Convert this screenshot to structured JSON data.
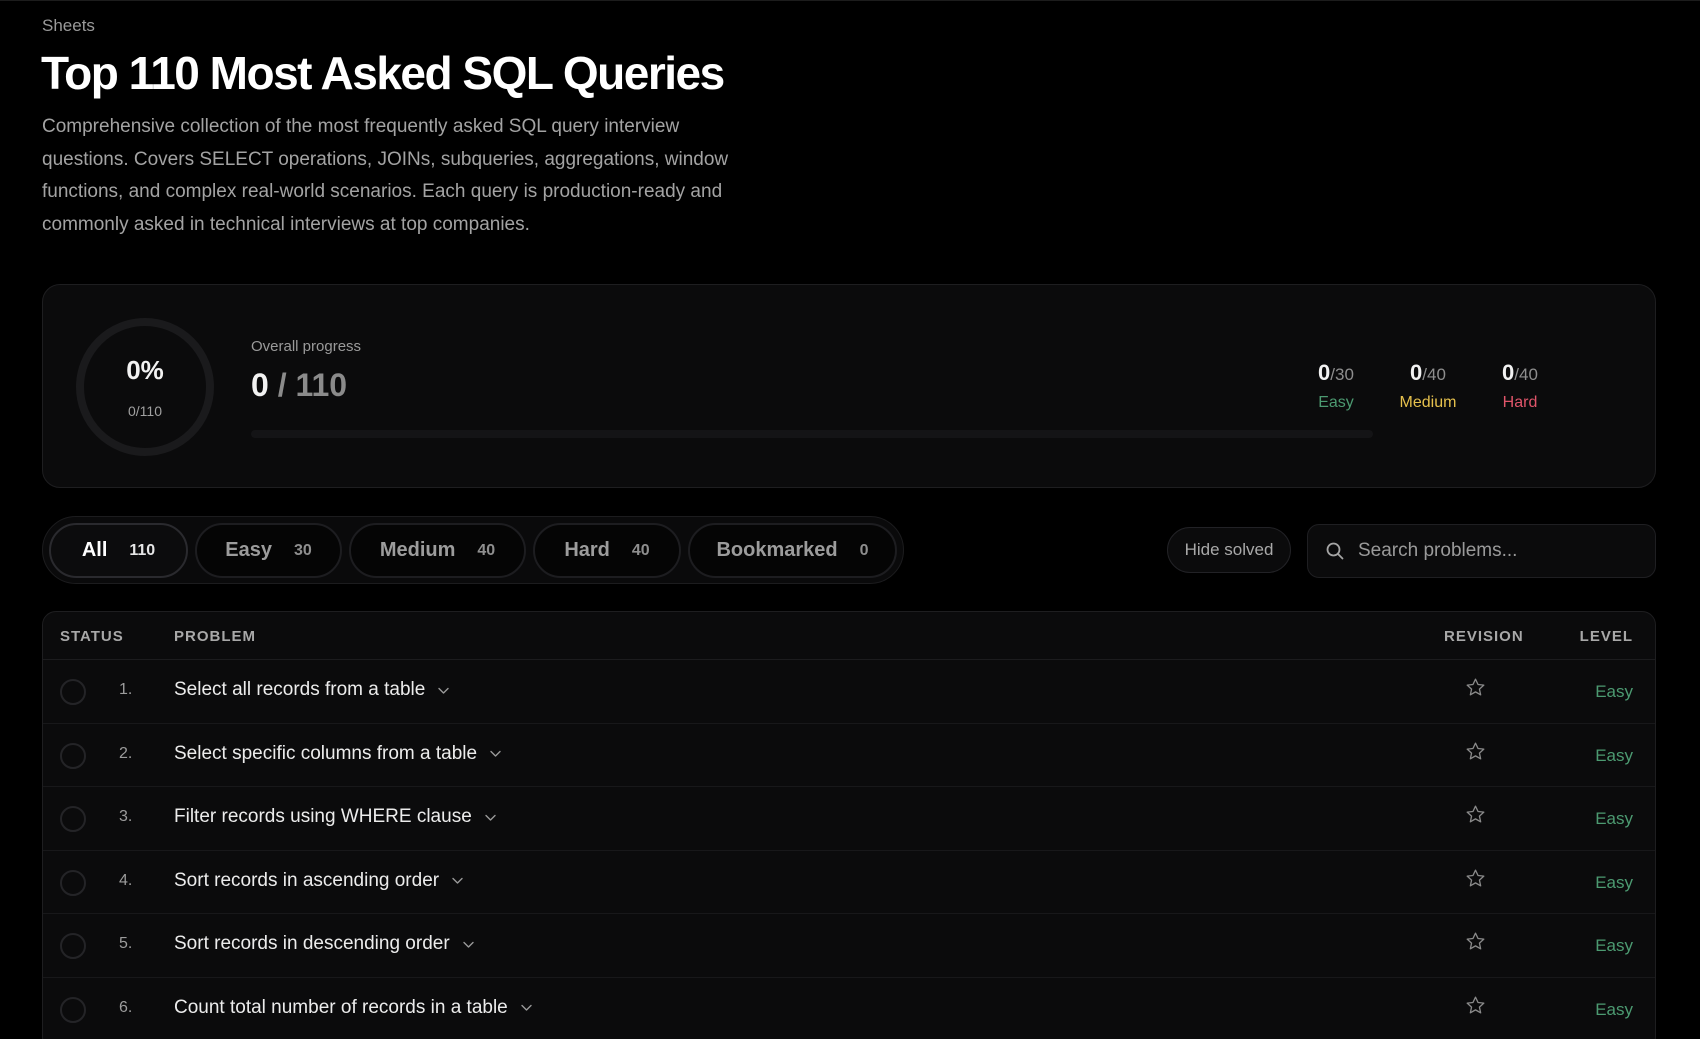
{
  "breadcrumb": "Sheets",
  "title": "Top 110 Most Asked SQL Queries",
  "description": "Comprehensive collection of the most frequently asked SQL query interview questions. Covers SELECT operations, JOINs, subqueries, aggregations, window functions, and complex real-world scenarios. Each query is production-ready and commonly asked in technical interviews at top companies.",
  "progress": {
    "percent_label": "0%",
    "ring_count": "0/110",
    "fraction_complete": 0,
    "overall_label": "Overall progress",
    "solved": "0",
    "separator": " / ",
    "total": "110",
    "difficulties": [
      {
        "solved": "0",
        "total": "/30",
        "label": "Easy",
        "color": "#4c9a71"
      },
      {
        "solved": "0",
        "total": "/40",
        "label": "Medium",
        "color": "#e6c14d"
      },
      {
        "solved": "0",
        "total": "/40",
        "label": "Hard",
        "color": "#e0556a"
      }
    ]
  },
  "filters": [
    {
      "label": "All",
      "count": "110",
      "active": true
    },
    {
      "label": "Easy",
      "count": "30",
      "active": false
    },
    {
      "label": "Medium",
      "count": "40",
      "active": false
    },
    {
      "label": "Hard",
      "count": "40",
      "active": false
    },
    {
      "label": "Bookmarked",
      "count": "0",
      "active": false
    }
  ],
  "hide_solved_label": "Hide solved",
  "search": {
    "placeholder": "Search problems...",
    "value": ""
  },
  "table": {
    "headers": {
      "status": "STATUS",
      "problem": "PROBLEM",
      "revision": "REVISION",
      "level": "LEVEL"
    },
    "rows": [
      {
        "index": "1.",
        "title": "Select all records from a table",
        "level": "Easy"
      },
      {
        "index": "2.",
        "title": "Select specific columns from a table",
        "level": "Easy"
      },
      {
        "index": "3.",
        "title": "Filter records using WHERE clause",
        "level": "Easy"
      },
      {
        "index": "4.",
        "title": "Sort records in ascending order",
        "level": "Easy"
      },
      {
        "index": "5.",
        "title": "Sort records in descending order",
        "level": "Easy"
      },
      {
        "index": "6.",
        "title": "Count total number of records in a table",
        "level": "Easy"
      }
    ]
  },
  "icons": {
    "search": "search-icon",
    "chevron": "chevron-down-icon",
    "star": "star-icon"
  }
}
